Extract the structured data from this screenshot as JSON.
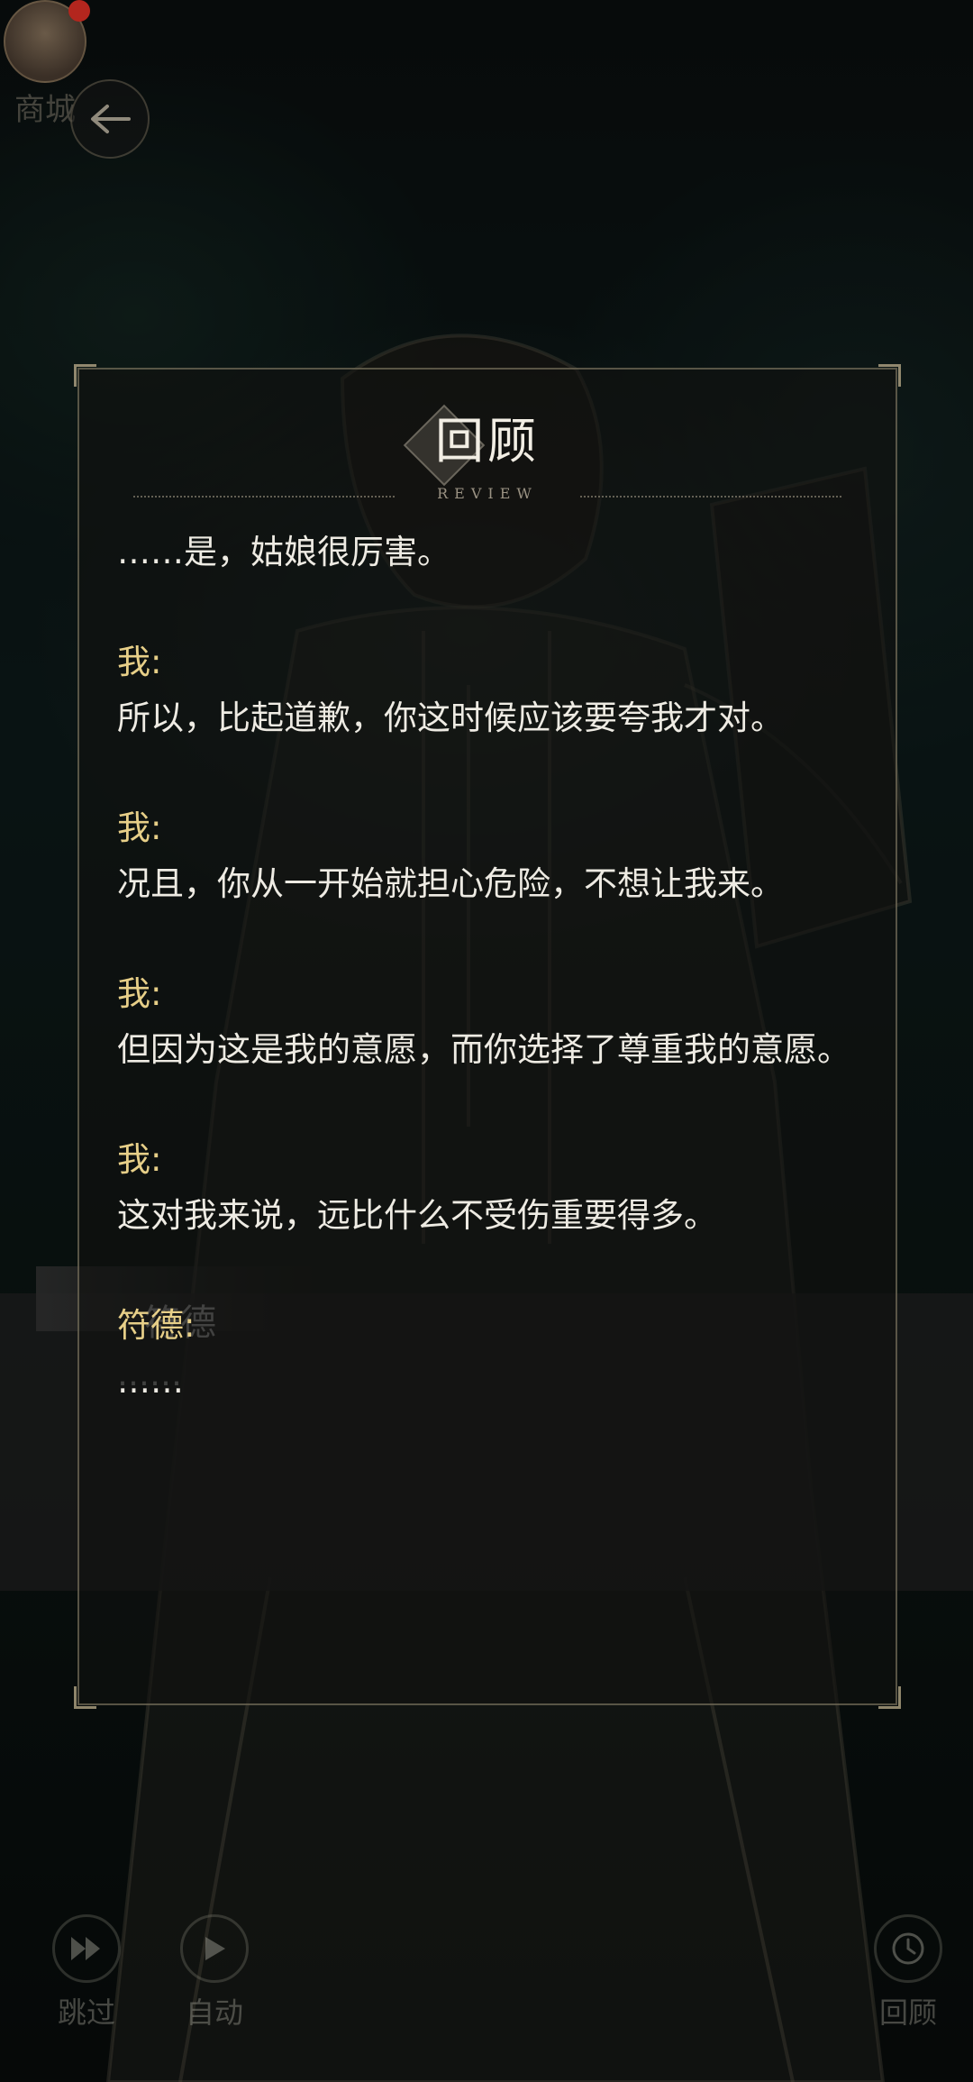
{
  "shop": {
    "label": "商城"
  },
  "game_dialog": {
    "speaker": "符德",
    "line": "……"
  },
  "bottom_controls": {
    "skip": "跳过",
    "auto": "自动",
    "review": "回顾"
  },
  "review": {
    "title": "回顾",
    "subtitle": "REVIEW",
    "entries": [
      {
        "name": "",
        "text": "……是，姑娘很厉害。"
      },
      {
        "name": "我:",
        "text": "所以，比起道歉，你这时候应该要夸我才对。"
      },
      {
        "name": "我:",
        "text": "况且，你从一开始就担心危险，不想让我来。"
      },
      {
        "name": "我:",
        "text": "但因为这是我的意愿，而你选择了尊重我的意愿。"
      },
      {
        "name": "我:",
        "text": "这对我来说，远比什么不受伤重要得多。"
      },
      {
        "name": "符德:",
        "text": "……"
      }
    ]
  },
  "colors": {
    "speaker_name": "#e7cf88",
    "log_text": "#eeebe3",
    "notification_dot": "#b3261e"
  },
  "icons": {
    "back": "back-arrow-icon",
    "skip": "fast-forward-icon",
    "auto": "play-icon",
    "review": "clock-icon"
  }
}
